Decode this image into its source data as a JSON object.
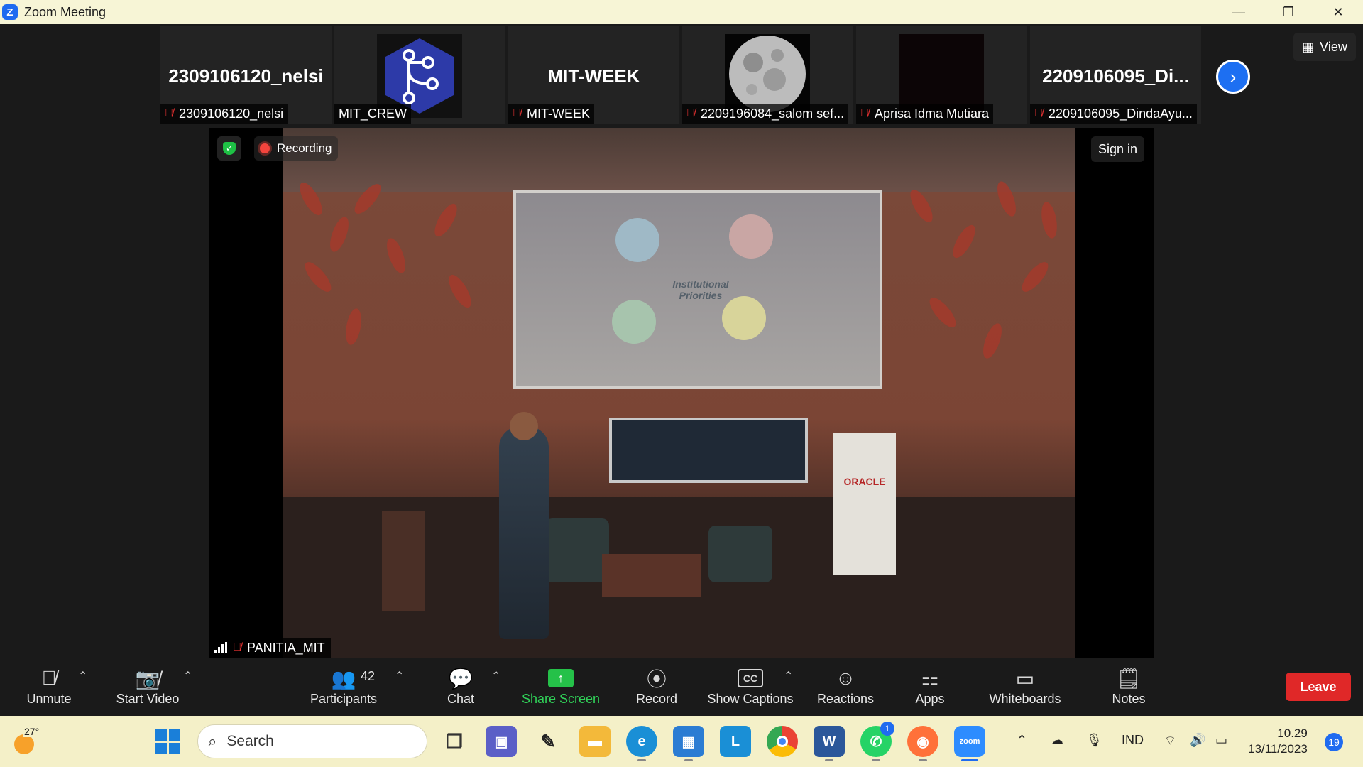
{
  "window": {
    "title": "Zoom Meeting",
    "minimize": "—",
    "restore": "❐",
    "close": "✕"
  },
  "gallery": {
    "tiles": [
      {
        "big_name": "2309106120_nelsi",
        "label": "2309106120_nelsi",
        "muted": true
      },
      {
        "big_name": "",
        "label": "MIT_CREW",
        "muted": false,
        "avatar": "hexagon-graph-logo"
      },
      {
        "big_name": "MIT-WEEK",
        "label": "MIT-WEEK",
        "muted": true
      },
      {
        "big_name": "",
        "label": "2209196084_salom sef...",
        "muted": true,
        "avatar": "moon-photo"
      },
      {
        "big_name": "",
        "label": "Aprisa Idma Mutiara",
        "muted": true,
        "avatar": "black-image"
      },
      {
        "big_name": "2209106095_Di...",
        "label": "2209106095_DindaAyu...",
        "muted": true
      }
    ],
    "view_label": "View"
  },
  "video": {
    "recording_label": "Recording",
    "sign_in_label": "Sign in",
    "speaker_name": "PANITIA_MIT",
    "slide_title": "Institutional Priorities",
    "banner_brand": "ORACLE"
  },
  "toolbar": {
    "unmute": "Unmute",
    "start_video": "Start Video",
    "participants": "Participants",
    "participants_count": "42",
    "chat": "Chat",
    "share_screen": "Share Screen",
    "record": "Record",
    "show_captions": "Show Captions",
    "cc": "CC",
    "reactions": "Reactions",
    "apps": "Apps",
    "whiteboards": "Whiteboards",
    "notes": "Notes",
    "leave": "Leave"
  },
  "taskbar": {
    "weather_temp": "27°",
    "search_placeholder": "Search",
    "whatsapp_badge": "1",
    "language": "IND",
    "time": "10.29",
    "date": "13/11/2023",
    "notifications": "19"
  }
}
